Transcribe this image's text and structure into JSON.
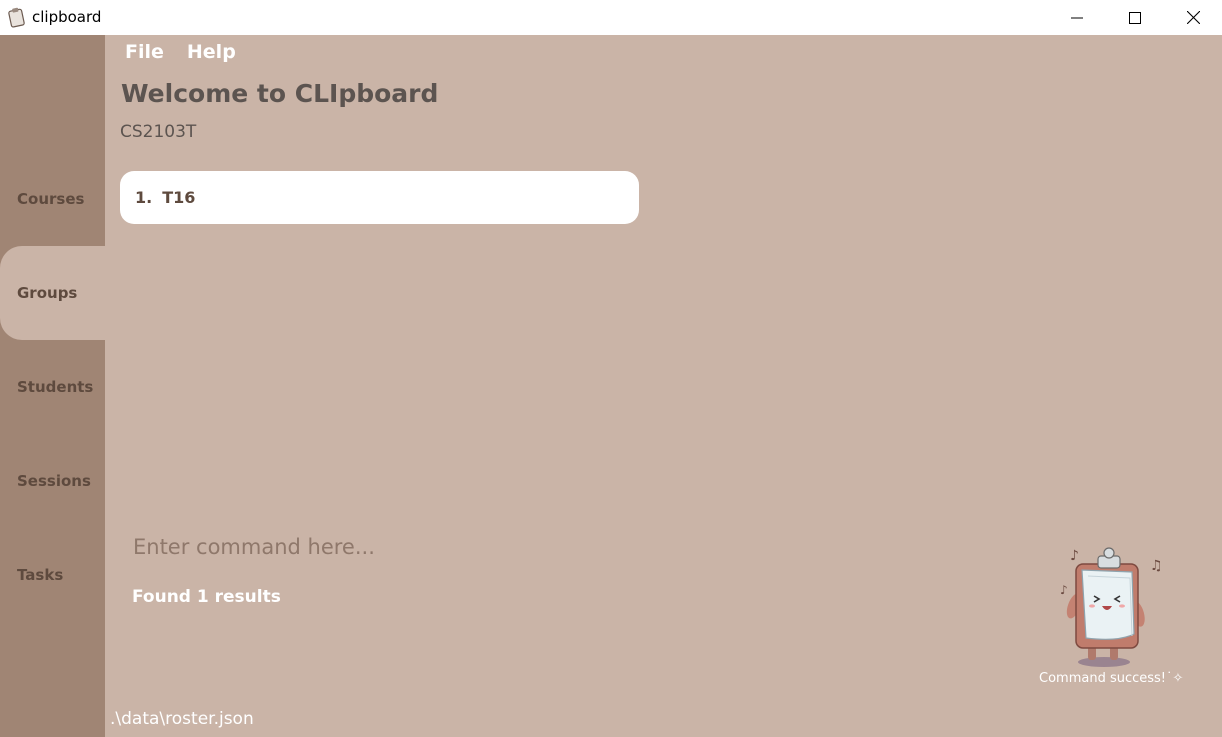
{
  "window": {
    "title": "clipboard",
    "icon": "clipboard-icon",
    "controls": [
      "minimize-icon",
      "maximize-icon",
      "close-icon"
    ]
  },
  "sidebar": {
    "items": [
      {
        "label": "Courses",
        "active": false
      },
      {
        "label": "Groups",
        "active": true
      },
      {
        "label": "Students",
        "active": false
      },
      {
        "label": "Sessions",
        "active": false
      },
      {
        "label": "Tasks",
        "active": false
      }
    ]
  },
  "menu": {
    "file": "File",
    "help": "Help"
  },
  "header": {
    "title": "Welcome to CLIpboard",
    "subtitle": "CS2103T"
  },
  "list": {
    "items": [
      {
        "index": "1.",
        "name": "T16"
      }
    ]
  },
  "command": {
    "value": "",
    "placeholder": "Enter command here..."
  },
  "result": {
    "text": "Found 1 results"
  },
  "status": {
    "path": ".\\data\\roster.json"
  },
  "mascot": {
    "icon": "clipboard-mascot-icon",
    "caption": "Command success!˙✧"
  },
  "colors": {
    "background": "#cab4a7",
    "sidebar": "#a08574",
    "nav_text": "#5e4a3e",
    "heading_text": "#5c5450",
    "card": "#ffffff"
  }
}
